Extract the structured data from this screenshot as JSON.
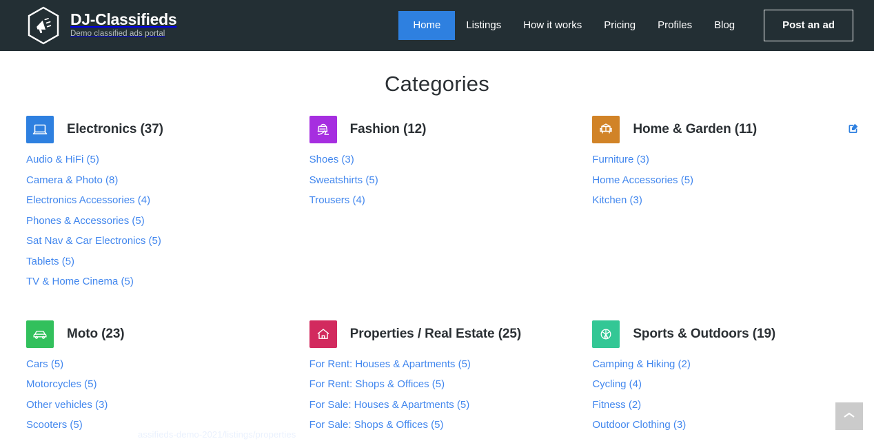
{
  "header": {
    "brand": {
      "title": "DJ-Classifieds",
      "subtitle": "Demo classified ads portal",
      "logo_icon": "megaphone-hexagon-logo"
    },
    "background_color": "#232f34",
    "nav": [
      {
        "label": "Home",
        "active": true
      },
      {
        "label": "Listings",
        "active": false
      },
      {
        "label": "How it works",
        "active": false
      },
      {
        "label": "Pricing",
        "active": false
      },
      {
        "label": "Profiles",
        "active": false
      },
      {
        "label": "Blog",
        "active": false
      }
    ],
    "cta_label": "Post an ad",
    "active_color": "#2e80e0"
  },
  "main": {
    "title": "Categories",
    "link_color": "#4287ee",
    "edit_badge_icon": "edit-square-icon",
    "categories": [
      {
        "title": "Electronics (37)",
        "icon": "laptop-icon",
        "icon_color": "#2e80e0",
        "subcategories": [
          "Audio & HiFi (5)",
          "Camera & Photo (8)",
          "Electronics Accessories (4)",
          "Phones & Accessories (5)",
          "Sat Nav & Car Electronics (5)",
          "Tablets (5)",
          "TV & Home Cinema (5)"
        ]
      },
      {
        "title": "Fashion (12)",
        "icon": "handbag-heel-icon",
        "icon_color": "#a62ee0",
        "subcategories": [
          "Shoes (3)",
          "Sweatshirts (5)",
          "Trousers (4)"
        ]
      },
      {
        "title": "Home & Garden (11)",
        "icon": "armchair-icon",
        "icon_color": "#d18327",
        "subcategories": [
          "Furniture (3)",
          "Home Accessories (5)",
          "Kitchen (3)"
        ]
      },
      {
        "title": "Moto (23)",
        "icon": "car-icon",
        "icon_color": "#32c05c",
        "subcategories": [
          "Cars (5)",
          "Motorcycles (5)",
          "Other vehicles (3)",
          "Scooters (5)"
        ]
      },
      {
        "title": "Properties / Real Estate (25)",
        "icon": "house-icon",
        "icon_color": "#d22a5e",
        "subcategories": [
          "For Rent: Houses & Apartments (5)",
          "For Rent: Shops & Offices (5)",
          "For Sale: Houses & Apartments (5)",
          "For Sale: Shops & Offices (5)"
        ]
      },
      {
        "title": "Sports & Outdoors (19)",
        "icon": "basketball-icon",
        "icon_color": "#33c795",
        "subcategories": [
          "Camping & Hiking (2)",
          "Cycling (4)",
          "Fitness (2)",
          "Outdoor Clothing (3)"
        ]
      }
    ]
  },
  "scroll_top": {
    "icon": "chevron-up-icon",
    "background_color": "#cbcbcb"
  },
  "status_ghost": "assifieds-demo-2021/listings/properties"
}
